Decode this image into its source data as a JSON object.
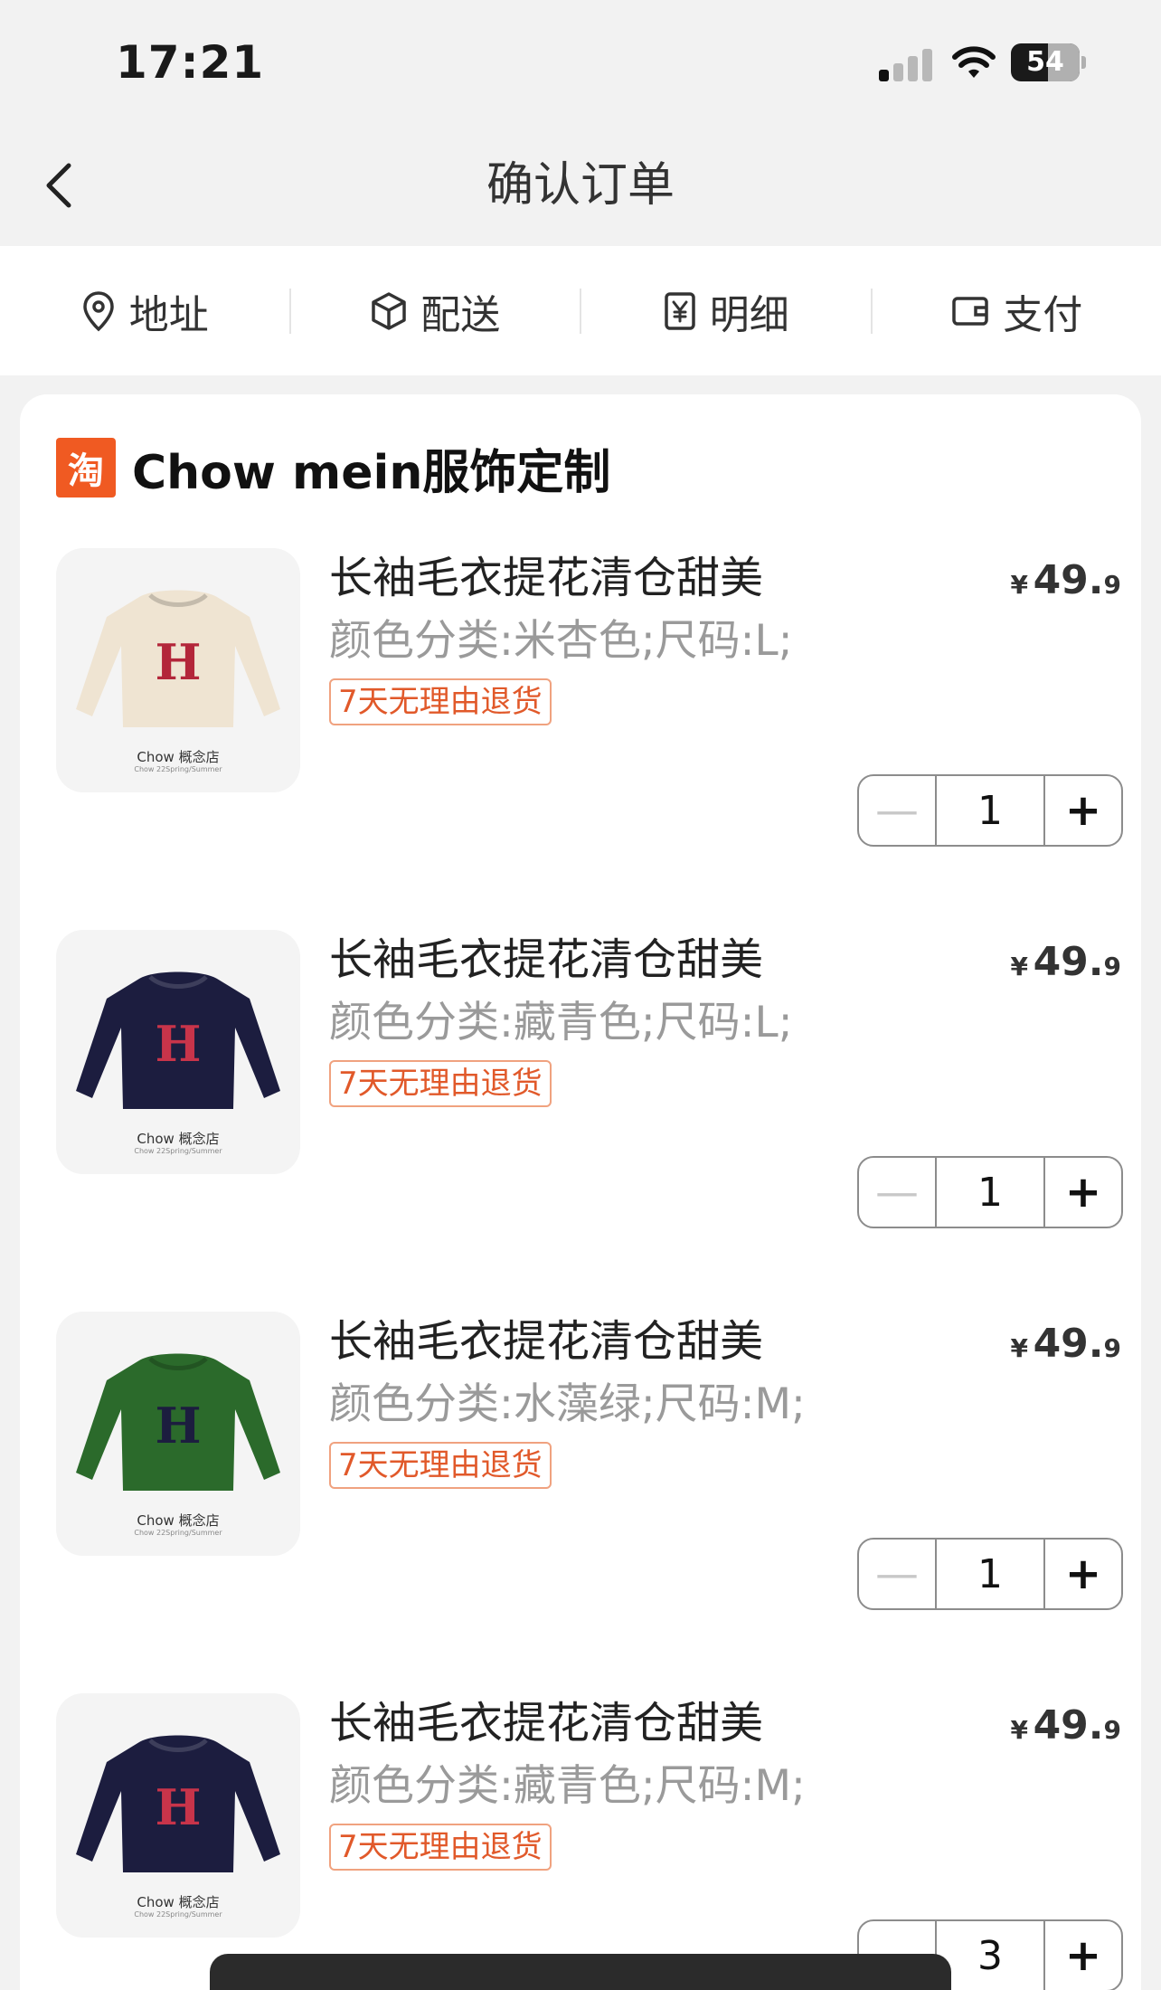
{
  "status_bar": {
    "time": "17:21",
    "battery": "54",
    "battery_level": 0.54
  },
  "nav": {
    "title": "确认订单",
    "back_icon": "chevron-left-icon"
  },
  "steps": [
    {
      "label": "地址",
      "icon": "location-pin-icon"
    },
    {
      "label": "配送",
      "icon": "package-box-icon"
    },
    {
      "label": "明细",
      "icon": "yen-receipt-icon"
    },
    {
      "label": "支付",
      "icon": "wallet-icon"
    }
  ],
  "shop": {
    "logo_text": "淘",
    "name": "Chow mein服饰定制"
  },
  "items": [
    {
      "title": "长袖毛衣提花清仓甜美",
      "spec": "颜色分类:米杏色;尺码:L;",
      "badge": "7天无理由退货",
      "price_symbol": "¥",
      "price_int": "49.",
      "price_dec": "9",
      "quantity": "1",
      "thumb_caption": "Chow 概念店",
      "thumb_sub": "Chow 22Spring/Summer",
      "sweater_color": "#efe4d2",
      "letter": "H",
      "letter_color": "#b3263a"
    },
    {
      "title": "长袖毛衣提花清仓甜美",
      "spec": "颜色分类:藏青色;尺码:L;",
      "badge": "7天无理由退货",
      "price_symbol": "¥",
      "price_int": "49.",
      "price_dec": "9",
      "quantity": "1",
      "thumb_caption": "Chow 概念店",
      "thumb_sub": "Chow 22Spring/Summer",
      "sweater_color": "#1c1d3f",
      "letter": "H",
      "letter_color": "#c8344a"
    },
    {
      "title": "长袖毛衣提花清仓甜美",
      "spec": "颜色分类:水藻绿;尺码:M;",
      "badge": "7天无理由退货",
      "price_symbol": "¥",
      "price_int": "49.",
      "price_dec": "9",
      "quantity": "1",
      "thumb_caption": "Chow 概念店",
      "thumb_sub": "Chow 22Spring/Summer",
      "sweater_color": "#2b6a2b",
      "letter": "H",
      "letter_color": "#1c1d3f"
    },
    {
      "title": "长袖毛衣提花清仓甜美",
      "spec": "颜色分类:藏青色;尺码:M;",
      "badge": "7天无理由退货",
      "price_symbol": "¥",
      "price_int": "49.",
      "price_dec": "9",
      "quantity": "3",
      "thumb_caption": "Chow 概念店",
      "thumb_sub": "Chow 22Spring/Summer",
      "sweater_color": "#1c1d3f",
      "letter": "H",
      "letter_color": "#c8344a"
    }
  ],
  "stepper": {
    "minus": "—",
    "plus": "+"
  },
  "colors": {
    "accent": "#e1592a",
    "shop_logo": "#f05a22"
  }
}
